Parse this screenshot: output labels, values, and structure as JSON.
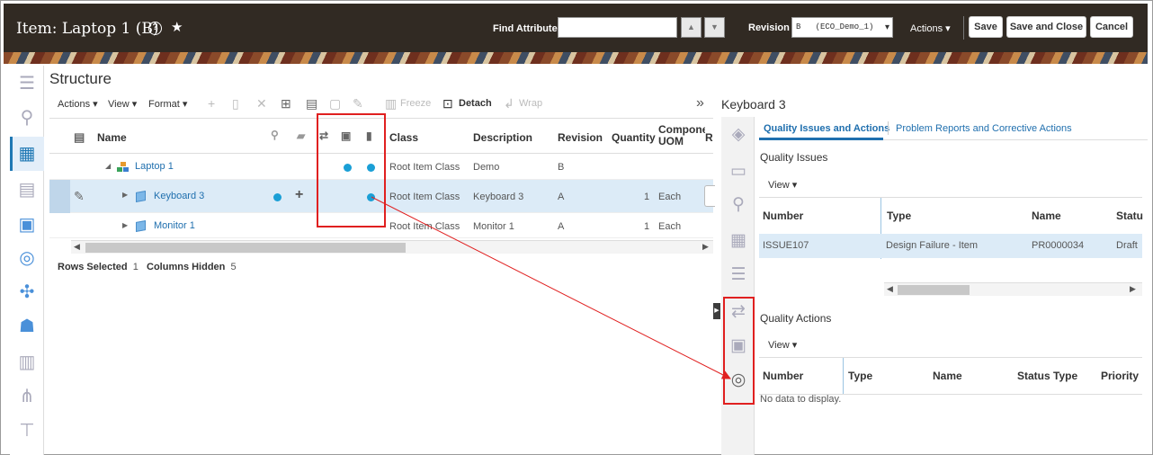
{
  "header": {
    "title": "Item: Laptop 1 (B)",
    "find_attribute_label": "Find Attribute",
    "revision_label": "Revision",
    "revision_value": "B   (ECO_Demo_1)",
    "actions_label": "Actions",
    "save_label": "Save",
    "save_close_label": "Save and Close",
    "cancel_label": "Cancel"
  },
  "structure": {
    "title": "Structure",
    "toolbar": {
      "actions": "Actions",
      "view": "View",
      "format": "Format",
      "freeze": "Freeze",
      "detach": "Detach",
      "wrap": "Wrap"
    },
    "columns": {
      "name": "Name",
      "class": "Class",
      "description": "Description",
      "revision": "Revision",
      "quantity": "Quantity",
      "component_uom": "Component UOM",
      "r": "R"
    },
    "rows": [
      {
        "name": "Laptop 1",
        "class": "Root Item Class",
        "description": "Demo",
        "revision": "B",
        "quantity": "",
        "uom": ""
      },
      {
        "name": "Keyboard 3",
        "class": "Root Item Class",
        "description": "Keyboard 3",
        "revision": "A",
        "quantity": "1",
        "uom": "Each"
      },
      {
        "name": "Monitor 1",
        "class": "Root Item Class",
        "description": "Monitor 1",
        "revision": "A",
        "quantity": "1",
        "uom": "Each"
      }
    ],
    "rows_selected_label": "Rows Selected",
    "rows_selected_value": "1",
    "columns_hidden_label": "Columns Hidden",
    "columns_hidden_value": "5"
  },
  "detail": {
    "title": "Keyboard 3",
    "tabs": [
      "Quality Issues and Actions",
      "Problem Reports and Corrective Actions"
    ],
    "quality_issues": {
      "heading": "Quality Issues",
      "view": "View",
      "columns": [
        "Number",
        "Type",
        "Name",
        "Statu"
      ],
      "rows": [
        {
          "number": "ISSUE107",
          "type": "Design Failure - Item",
          "name": "PR0000034",
          "status": "Draft"
        }
      ]
    },
    "quality_actions": {
      "heading": "Quality Actions",
      "view": "View",
      "columns": [
        "Number",
        "Type",
        "Name",
        "Status Type",
        "Priority"
      ],
      "empty": "No data to display."
    }
  },
  "colors": {
    "header_bg": "#312a23",
    "accent": "#1f6fae",
    "dot": "#1a9fd6",
    "highlight": "#e02020",
    "selected_row": "#dcebf7"
  }
}
